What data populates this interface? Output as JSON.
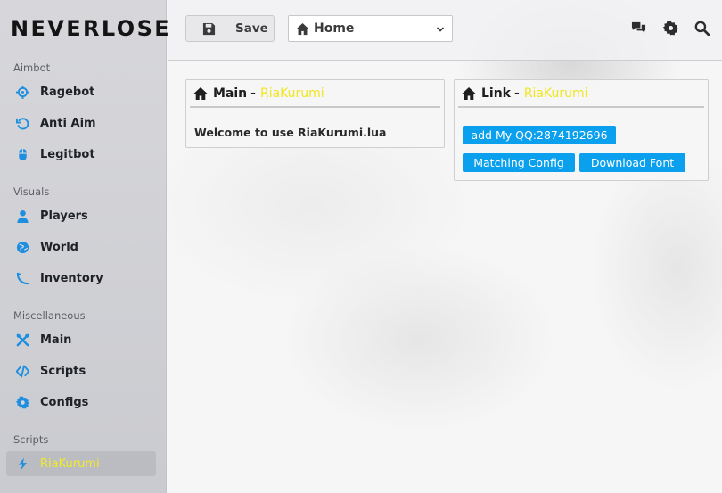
{
  "app": {
    "logo": "NEVERLOSE"
  },
  "sidebar": {
    "sections": [
      {
        "label": "Aimbot",
        "items": [
          {
            "label": "Ragebot",
            "icon": "crosshair-icon"
          },
          {
            "label": "Anti Aim",
            "icon": "rotate-icon"
          },
          {
            "label": "Legitbot",
            "icon": "mouse-icon"
          }
        ]
      },
      {
        "label": "Visuals",
        "items": [
          {
            "label": "Players",
            "icon": "user-icon"
          },
          {
            "label": "World",
            "icon": "globe-icon"
          },
          {
            "label": "Inventory",
            "icon": "hook-icon"
          }
        ]
      },
      {
        "label": "Miscellaneous",
        "items": [
          {
            "label": "Main",
            "icon": "tools-icon"
          },
          {
            "label": "Scripts",
            "icon": "code-icon"
          },
          {
            "label": "Configs",
            "icon": "gear-icon"
          }
        ]
      },
      {
        "label": "Scripts",
        "items": [
          {
            "label": "RiaKurumi",
            "icon": "bolt-icon",
            "active": true
          }
        ]
      }
    ]
  },
  "toolbar": {
    "save_label": "Save",
    "select_value": "Home"
  },
  "panels": {
    "main": {
      "title": "Main",
      "separator": "-",
      "name": "RiaKurumi",
      "text": "Welcome to use RiaKurumi.lua"
    },
    "link": {
      "title": "Link",
      "separator": "-",
      "name": "RiaKurumi",
      "buttons": [
        "add My QQ:2874192696",
        "Matching Config",
        "Download Font"
      ]
    }
  },
  "colors": {
    "accent_blue": "#0aa0ee",
    "accent_yellow": "#f0e61e",
    "icon_blue": "#1e8fe0"
  }
}
